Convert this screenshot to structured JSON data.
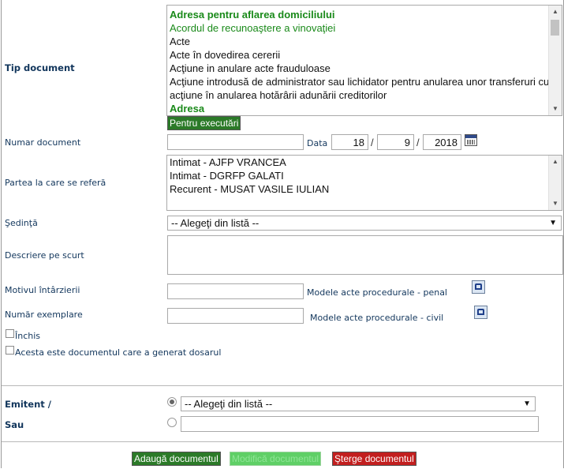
{
  "tip_document": {
    "label": "Tip document",
    "options": [
      {
        "text": "Adresa pentru aflarea domiciliului",
        "style": "gb"
      },
      {
        "text": "Acordul de recunoaştere a vinovaţiei",
        "style": "g"
      },
      {
        "text": "Acte",
        "style": ""
      },
      {
        "text": "Acte în dovedirea cererii",
        "style": ""
      },
      {
        "text": "Acţiune in anulare acte frauduloase",
        "style": ""
      },
      {
        "text": "Acţiune introdusă de administrator sau lichidator pentru anularea unor transferuri cu",
        "style": ""
      },
      {
        "text": "acţiune în anularea hotărârii adunării creditorilor",
        "style": ""
      },
      {
        "text": "Adresa",
        "style": "gb"
      }
    ],
    "pentru_executari_label": "Pentru executări"
  },
  "numar_document": {
    "label": "Numar document",
    "value": "",
    "data_label": "Data",
    "day": "18",
    "month": "9",
    "year": "2018",
    "separator": "/"
  },
  "partea": {
    "label": "Partea la care se referă",
    "items": [
      "Intimat - AJFP VRANCEA",
      "Intimat - DGRFP GALATI",
      "Recurent - MUSAT VASILE IULIAN"
    ]
  },
  "sedinta": {
    "label": "Şedinţă",
    "selected": "-- Alegeţi din listă --"
  },
  "descriere": {
    "label": "Descriere pe scurt",
    "value": ""
  },
  "motivul": {
    "label": "Motivul întârzierii",
    "value": "",
    "link": "Modele acte procedurale - penal"
  },
  "numar_exemplare": {
    "label": "Număr exemplare",
    "value": "",
    "link": "Modele acte procedurale - civil"
  },
  "checkboxes": {
    "inchis": "Închis",
    "generat": "Acesta este documentul care a generat dosarul"
  },
  "emitent": {
    "label": "Emitent /",
    "selected": "-- Alegeţi din listă --",
    "sau_label": "Sau",
    "sau_value": ""
  },
  "actions": {
    "add": "Adaugă documentul",
    "modify": "Modifică documentul",
    "delete": "Şterge documentul"
  },
  "colors": {
    "label_text": "#12365c",
    "green_button": "#2b7a28",
    "disabled_button": "#5fcf66",
    "red_button": "#c21f1f",
    "green_option": "#1a8a1a"
  }
}
